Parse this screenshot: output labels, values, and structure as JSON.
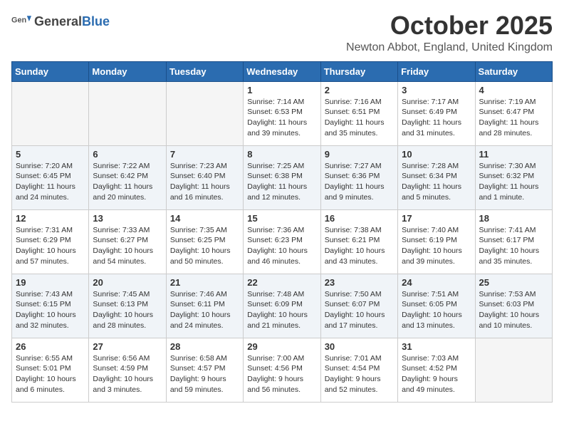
{
  "header": {
    "logo_general": "General",
    "logo_blue": "Blue",
    "month_title": "October 2025",
    "location": "Newton Abbot, England, United Kingdom"
  },
  "calendar": {
    "days_of_week": [
      "Sunday",
      "Monday",
      "Tuesday",
      "Wednesday",
      "Thursday",
      "Friday",
      "Saturday"
    ],
    "weeks": [
      [
        {
          "day": "",
          "info": ""
        },
        {
          "day": "",
          "info": ""
        },
        {
          "day": "",
          "info": ""
        },
        {
          "day": "1",
          "info": "Sunrise: 7:14 AM\nSunset: 6:53 PM\nDaylight: 11 hours\nand 39 minutes."
        },
        {
          "day": "2",
          "info": "Sunrise: 7:16 AM\nSunset: 6:51 PM\nDaylight: 11 hours\nand 35 minutes."
        },
        {
          "day": "3",
          "info": "Sunrise: 7:17 AM\nSunset: 6:49 PM\nDaylight: 11 hours\nand 31 minutes."
        },
        {
          "day": "4",
          "info": "Sunrise: 7:19 AM\nSunset: 6:47 PM\nDaylight: 11 hours\nand 28 minutes."
        }
      ],
      [
        {
          "day": "5",
          "info": "Sunrise: 7:20 AM\nSunset: 6:45 PM\nDaylight: 11 hours\nand 24 minutes."
        },
        {
          "day": "6",
          "info": "Sunrise: 7:22 AM\nSunset: 6:42 PM\nDaylight: 11 hours\nand 20 minutes."
        },
        {
          "day": "7",
          "info": "Sunrise: 7:23 AM\nSunset: 6:40 PM\nDaylight: 11 hours\nand 16 minutes."
        },
        {
          "day": "8",
          "info": "Sunrise: 7:25 AM\nSunset: 6:38 PM\nDaylight: 11 hours\nand 12 minutes."
        },
        {
          "day": "9",
          "info": "Sunrise: 7:27 AM\nSunset: 6:36 PM\nDaylight: 11 hours\nand 9 minutes."
        },
        {
          "day": "10",
          "info": "Sunrise: 7:28 AM\nSunset: 6:34 PM\nDaylight: 11 hours\nand 5 minutes."
        },
        {
          "day": "11",
          "info": "Sunrise: 7:30 AM\nSunset: 6:32 PM\nDaylight: 11 hours\nand 1 minute."
        }
      ],
      [
        {
          "day": "12",
          "info": "Sunrise: 7:31 AM\nSunset: 6:29 PM\nDaylight: 10 hours\nand 57 minutes."
        },
        {
          "day": "13",
          "info": "Sunrise: 7:33 AM\nSunset: 6:27 PM\nDaylight: 10 hours\nand 54 minutes."
        },
        {
          "day": "14",
          "info": "Sunrise: 7:35 AM\nSunset: 6:25 PM\nDaylight: 10 hours\nand 50 minutes."
        },
        {
          "day": "15",
          "info": "Sunrise: 7:36 AM\nSunset: 6:23 PM\nDaylight: 10 hours\nand 46 minutes."
        },
        {
          "day": "16",
          "info": "Sunrise: 7:38 AM\nSunset: 6:21 PM\nDaylight: 10 hours\nand 43 minutes."
        },
        {
          "day": "17",
          "info": "Sunrise: 7:40 AM\nSunset: 6:19 PM\nDaylight: 10 hours\nand 39 minutes."
        },
        {
          "day": "18",
          "info": "Sunrise: 7:41 AM\nSunset: 6:17 PM\nDaylight: 10 hours\nand 35 minutes."
        }
      ],
      [
        {
          "day": "19",
          "info": "Sunrise: 7:43 AM\nSunset: 6:15 PM\nDaylight: 10 hours\nand 32 minutes."
        },
        {
          "day": "20",
          "info": "Sunrise: 7:45 AM\nSunset: 6:13 PM\nDaylight: 10 hours\nand 28 minutes."
        },
        {
          "day": "21",
          "info": "Sunrise: 7:46 AM\nSunset: 6:11 PM\nDaylight: 10 hours\nand 24 minutes."
        },
        {
          "day": "22",
          "info": "Sunrise: 7:48 AM\nSunset: 6:09 PM\nDaylight: 10 hours\nand 21 minutes."
        },
        {
          "day": "23",
          "info": "Sunrise: 7:50 AM\nSunset: 6:07 PM\nDaylight: 10 hours\nand 17 minutes."
        },
        {
          "day": "24",
          "info": "Sunrise: 7:51 AM\nSunset: 6:05 PM\nDaylight: 10 hours\nand 13 minutes."
        },
        {
          "day": "25",
          "info": "Sunrise: 7:53 AM\nSunset: 6:03 PM\nDaylight: 10 hours\nand 10 minutes."
        }
      ],
      [
        {
          "day": "26",
          "info": "Sunrise: 6:55 AM\nSunset: 5:01 PM\nDaylight: 10 hours\nand 6 minutes."
        },
        {
          "day": "27",
          "info": "Sunrise: 6:56 AM\nSunset: 4:59 PM\nDaylight: 10 hours\nand 3 minutes."
        },
        {
          "day": "28",
          "info": "Sunrise: 6:58 AM\nSunset: 4:57 PM\nDaylight: 9 hours\nand 59 minutes."
        },
        {
          "day": "29",
          "info": "Sunrise: 7:00 AM\nSunset: 4:56 PM\nDaylight: 9 hours\nand 56 minutes."
        },
        {
          "day": "30",
          "info": "Sunrise: 7:01 AM\nSunset: 4:54 PM\nDaylight: 9 hours\nand 52 minutes."
        },
        {
          "day": "31",
          "info": "Sunrise: 7:03 AM\nSunset: 4:52 PM\nDaylight: 9 hours\nand 49 minutes."
        },
        {
          "day": "",
          "info": ""
        }
      ]
    ]
  }
}
